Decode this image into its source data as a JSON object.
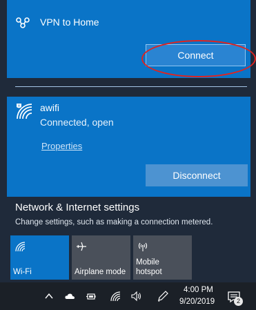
{
  "vpn": {
    "name": "VPN to Home",
    "connect_label": "Connect"
  },
  "wifi": {
    "name": "awifi",
    "status": "Connected, open",
    "properties_label": "Properties",
    "disconnect_label": "Disconnect"
  },
  "settings": {
    "title": "Network & Internet settings",
    "subtitle": "Change settings, such as making a connection metered."
  },
  "tiles": [
    {
      "label": "Wi-Fi",
      "icon": "wifi-icon",
      "active": true
    },
    {
      "label": "Airplane mode",
      "icon": "airplane-icon",
      "active": false
    },
    {
      "label_line1": "Mobile",
      "label_line2": "hotspot",
      "icon": "hotspot-icon",
      "active": false
    }
  ],
  "taskbar": {
    "time": "4:00 PM",
    "date": "9/20/2019",
    "notification_count": "2"
  },
  "colors": {
    "accent": "#0a74c7",
    "highlight": "#e0241f"
  }
}
